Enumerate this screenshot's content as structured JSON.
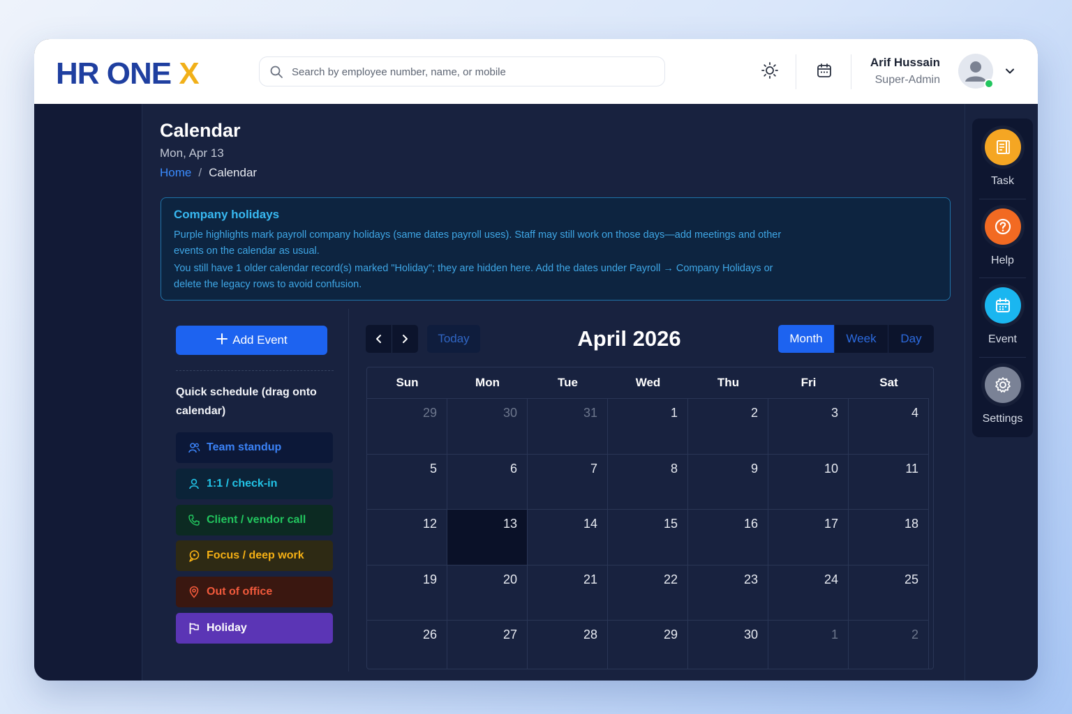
{
  "brand": {
    "logo_main": "HR ONE",
    "logo_accent": "X"
  },
  "search": {
    "placeholder": "Search by employee number, name, or mobile"
  },
  "header_icons": [
    "sun-icon",
    "calendar-icon",
    "chevron-down-icon"
  ],
  "user": {
    "name": "Arif Hussain",
    "role": "Super-Admin",
    "status": "online"
  },
  "page": {
    "title": "Calendar",
    "date": "Mon, Apr 13",
    "breadcrumb": {
      "home": "Home",
      "separator": "/",
      "current": "Calendar"
    }
  },
  "notice": {
    "title": "Company holidays",
    "line1": "Purple highlights mark payroll company holidays (same dates payroll uses). Staff may still work on those days—add meetings and other events on the calendar as usual.",
    "line2": "You still have 1 older calendar record(s) marked \"Holiday\"; they are hidden here. Add the dates under Payroll → Company Holidays or delete the legacy rows to avoid confusion."
  },
  "quick": {
    "add_label": "Add Event",
    "title": "Quick schedule (drag onto calendar)",
    "items": [
      {
        "label": "Team standup",
        "icon": "users-icon",
        "color": "#3b82f6",
        "bg": "#0c1838"
      },
      {
        "label": "1:1 / check-in",
        "icon": "user-icon",
        "color": "#22c3e6",
        "bg": "#0b2338"
      },
      {
        "label": "Client / vendor call",
        "icon": "phone-icon",
        "color": "#22c55e",
        "bg": "#0c2a22"
      },
      {
        "label": "Focus / deep work",
        "icon": "focus-icon",
        "color": "#f5b014",
        "bg": "#2e2a14"
      },
      {
        "label": "Out of office",
        "icon": "location-pin-icon",
        "color": "#f25a3c",
        "bg": "#3a1710"
      },
      {
        "label": "Holiday",
        "icon": "flag-icon",
        "color": "#ffffff",
        "bg": "#5b35b5"
      }
    ]
  },
  "calendar": {
    "title": "April 2026",
    "today_label": "Today",
    "views": [
      "Month",
      "Week",
      "Day"
    ],
    "active_view": "Month",
    "weekdays": [
      "Sun",
      "Mon",
      "Tue",
      "Wed",
      "Thu",
      "Fri",
      "Sat"
    ],
    "weeks": [
      [
        {
          "d": "29",
          "m": true
        },
        {
          "d": "30",
          "m": true
        },
        {
          "d": "31",
          "m": true
        },
        {
          "d": "1"
        },
        {
          "d": "2"
        },
        {
          "d": "3"
        },
        {
          "d": "4"
        }
      ],
      [
        {
          "d": "5"
        },
        {
          "d": "6"
        },
        {
          "d": "7"
        },
        {
          "d": "8"
        },
        {
          "d": "9"
        },
        {
          "d": "10"
        },
        {
          "d": "11"
        }
      ],
      [
        {
          "d": "12"
        },
        {
          "d": "13",
          "t": true
        },
        {
          "d": "14"
        },
        {
          "d": "15"
        },
        {
          "d": "16"
        },
        {
          "d": "17"
        },
        {
          "d": "18"
        }
      ],
      [
        {
          "d": "19"
        },
        {
          "d": "20"
        },
        {
          "d": "21"
        },
        {
          "d": "22"
        },
        {
          "d": "23"
        },
        {
          "d": "24"
        },
        {
          "d": "25"
        }
      ],
      [
        {
          "d": "26"
        },
        {
          "d": "27"
        },
        {
          "d": "28"
        },
        {
          "d": "29"
        },
        {
          "d": "30"
        },
        {
          "d": "1",
          "m": true
        },
        {
          "d": "2",
          "m": true
        }
      ]
    ]
  },
  "right_panel": [
    {
      "label": "Task",
      "icon": "task-icon",
      "color": "#f5a623"
    },
    {
      "label": "Help",
      "icon": "help-icon",
      "color": "#f26a22"
    },
    {
      "label": "Event",
      "icon": "event-calendar-icon",
      "color": "#1ab6f0"
    },
    {
      "label": "Settings",
      "icon": "settings-icon",
      "color": "#7a8296"
    }
  ]
}
